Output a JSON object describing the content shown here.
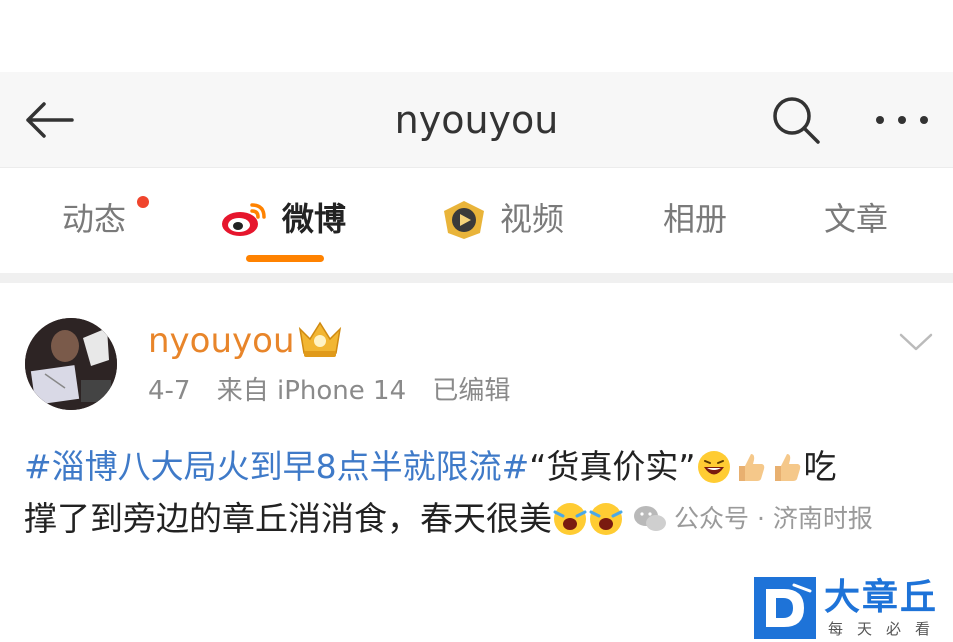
{
  "header": {
    "title": "nyouyou"
  },
  "tabs": [
    {
      "label": "动态",
      "has_dot": true
    },
    {
      "label": "微博",
      "active": true
    },
    {
      "label": "视频"
    },
    {
      "label": "相册"
    },
    {
      "label": "文章"
    }
  ],
  "post": {
    "username": "nyouyou",
    "date": "4-7",
    "source": "来自 iPhone 14",
    "edited": "已编辑",
    "hashtag": "#淄博八大局火到早8点半就限流#",
    "text_line1": " “货真价实”",
    "text_line1_end": "吃",
    "text_line2": "撑了到旁边的章丘消消食，春天很美",
    "watermark": "公众号 · 济南时报"
  },
  "logo": {
    "name": "大章丘",
    "slogan": "每天必看"
  },
  "colors": {
    "accent_orange": "#ff8200",
    "hashtag_blue": "#3f7ac8",
    "username_orange": "#e8852a",
    "logo_blue": "#1e73d8"
  }
}
